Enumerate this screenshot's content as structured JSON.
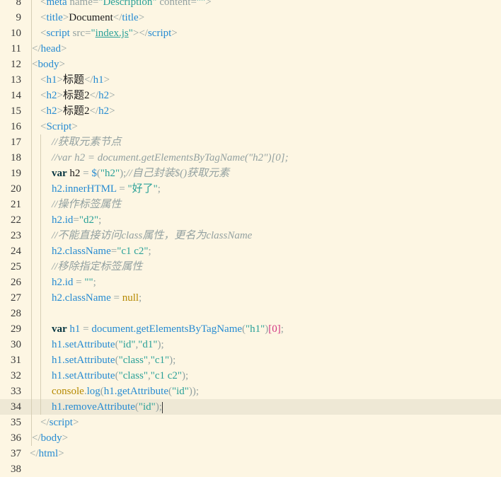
{
  "colors": {
    "background": "#fdf6e3",
    "active_line": "#eee8d5",
    "punct": "#93a1a1",
    "tag": "#268bd2",
    "attr": "#93a1a1",
    "string": "#2aa198",
    "keyword": "#073642",
    "builtin": "#b58900",
    "comment": "#93a1a1",
    "text": "#586e75",
    "number": "#d33682"
  },
  "lines": [
    {
      "n": "8",
      "indent": 1,
      "tokens": [
        [
          "p",
          "<"
        ],
        [
          "tag",
          "meta"
        ],
        [
          "t",
          " "
        ],
        [
          "attr",
          "name"
        ],
        [
          "p",
          "="
        ],
        [
          "s",
          "\"Description\""
        ],
        [
          "t",
          " "
        ],
        [
          "attr",
          "content"
        ],
        [
          "p",
          "="
        ],
        [
          "s",
          "\"\""
        ],
        [
          "p",
          ">"
        ]
      ]
    },
    {
      "n": "9",
      "indent": 1,
      "tokens": [
        [
          "p",
          "<"
        ],
        [
          "tag",
          "title"
        ],
        [
          "p",
          ">"
        ],
        [
          "t",
          "Document"
        ],
        [
          "p",
          "</"
        ],
        [
          "tag",
          "title"
        ],
        [
          "p",
          ">"
        ]
      ]
    },
    {
      "n": "10",
      "indent": 1,
      "tokens": [
        [
          "p",
          "<"
        ],
        [
          "tag",
          "script"
        ],
        [
          "t",
          " "
        ],
        [
          "attr",
          "src"
        ],
        [
          "p",
          "="
        ],
        [
          "s",
          "\""
        ],
        [
          "su",
          "index.js"
        ],
        [
          "s",
          "\""
        ],
        [
          "p",
          "></"
        ],
        [
          "tag",
          "script"
        ],
        [
          "p",
          ">"
        ]
      ]
    },
    {
      "n": "11",
      "indent": 0,
      "tokens": [
        [
          "p",
          "</"
        ],
        [
          "tag",
          "head"
        ],
        [
          "p",
          ">"
        ]
      ]
    },
    {
      "n": "12",
      "indent": 0,
      "tokens": [
        [
          "p",
          "<"
        ],
        [
          "tag",
          "body"
        ],
        [
          "p",
          ">"
        ]
      ]
    },
    {
      "n": "13",
      "indent": 1,
      "tokens": [
        [
          "p",
          "<"
        ],
        [
          "tag",
          "h1"
        ],
        [
          "p",
          ">"
        ],
        [
          "t",
          "标题"
        ],
        [
          "p",
          "</"
        ],
        [
          "tag",
          "h1"
        ],
        [
          "p",
          ">"
        ]
      ]
    },
    {
      "n": "14",
      "indent": 1,
      "tokens": [
        [
          "p",
          "<"
        ],
        [
          "tag",
          "h2"
        ],
        [
          "p",
          ">"
        ],
        [
          "t",
          "标题2"
        ],
        [
          "p",
          "</"
        ],
        [
          "tag",
          "h2"
        ],
        [
          "p",
          ">"
        ]
      ]
    },
    {
      "n": "15",
      "indent": 1,
      "tokens": [
        [
          "p",
          "<"
        ],
        [
          "tag",
          "h2"
        ],
        [
          "p",
          ">"
        ],
        [
          "t",
          "标题2"
        ],
        [
          "p",
          "</"
        ],
        [
          "tag",
          "h2"
        ],
        [
          "p",
          ">"
        ]
      ]
    },
    {
      "n": "16",
      "indent": 1,
      "tokens": [
        [
          "p",
          "<"
        ],
        [
          "tag",
          "Script"
        ],
        [
          "p",
          ">"
        ]
      ]
    },
    {
      "n": "17",
      "indent": 2,
      "tokens": [
        [
          "c",
          "//获取元素节点"
        ]
      ]
    },
    {
      "n": "18",
      "indent": 2,
      "tokens": [
        [
          "c",
          "//var h2 = document.getElementsByTagName(\"h2\")[0];"
        ]
      ]
    },
    {
      "n": "19",
      "indent": 2,
      "tokens": [
        [
          "k",
          "var"
        ],
        [
          "t",
          " h2 "
        ],
        [
          "p",
          "="
        ],
        [
          "t",
          " "
        ],
        [
          "f",
          "$"
        ],
        [
          "p",
          "("
        ],
        [
          "s",
          "\"h2\""
        ],
        [
          "p",
          ");"
        ],
        [
          "c",
          "//自己封装$()获取元素"
        ]
      ]
    },
    {
      "n": "20",
      "indent": 2,
      "tokens": [
        [
          "v",
          "h2.innerHTML"
        ],
        [
          "t",
          " "
        ],
        [
          "p",
          "="
        ],
        [
          "t",
          " "
        ],
        [
          "s",
          "\"好了\""
        ],
        [
          "p",
          ";"
        ]
      ]
    },
    {
      "n": "21",
      "indent": 2,
      "tokens": [
        [
          "c",
          "//操作标签属性"
        ]
      ]
    },
    {
      "n": "22",
      "indent": 2,
      "tokens": [
        [
          "v",
          "h2.id"
        ],
        [
          "p",
          "="
        ],
        [
          "s",
          "\"d2\""
        ],
        [
          "p",
          ";"
        ]
      ]
    },
    {
      "n": "23",
      "indent": 2,
      "tokens": [
        [
          "c",
          "//不能直接访问class属性，更名为className"
        ]
      ]
    },
    {
      "n": "24",
      "indent": 2,
      "tokens": [
        [
          "v",
          "h2.className"
        ],
        [
          "p",
          "="
        ],
        [
          "s",
          "\"c1 c2\""
        ],
        [
          "p",
          ";"
        ]
      ]
    },
    {
      "n": "25",
      "indent": 2,
      "tokens": [
        [
          "c",
          "//移除指定标签属性"
        ]
      ]
    },
    {
      "n": "26",
      "indent": 2,
      "tokens": [
        [
          "v",
          "h2.id"
        ],
        [
          "t",
          " "
        ],
        [
          "p",
          "="
        ],
        [
          "t",
          " "
        ],
        [
          "s",
          "\"\""
        ],
        [
          "p",
          ";"
        ]
      ]
    },
    {
      "n": "27",
      "indent": 2,
      "tokens": [
        [
          "v",
          "h2.className"
        ],
        [
          "t",
          " "
        ],
        [
          "p",
          "="
        ],
        [
          "t",
          " "
        ],
        [
          "b",
          "null"
        ],
        [
          "p",
          ";"
        ]
      ]
    },
    {
      "n": "28",
      "indent": 2,
      "tokens": []
    },
    {
      "n": "29",
      "indent": 2,
      "tokens": [
        [
          "k",
          "var"
        ],
        [
          "t",
          " "
        ],
        [
          "v",
          "h1"
        ],
        [
          "t",
          " "
        ],
        [
          "p",
          "="
        ],
        [
          "t",
          " "
        ],
        [
          "v",
          "document.getElementsByTagName"
        ],
        [
          "p",
          "("
        ],
        [
          "s",
          "\"h1\""
        ],
        [
          "p",
          ")"
        ],
        [
          "n",
          "[0]"
        ],
        [
          "p",
          ";"
        ]
      ]
    },
    {
      "n": "30",
      "indent": 2,
      "tokens": [
        [
          "v",
          "h1.setAttribute"
        ],
        [
          "p",
          "("
        ],
        [
          "s",
          "\"id\""
        ],
        [
          "p",
          ","
        ],
        [
          "s",
          "\"d1\""
        ],
        [
          "p",
          ");"
        ]
      ]
    },
    {
      "n": "31",
      "indent": 2,
      "tokens": [
        [
          "v",
          "h1.setAttribute"
        ],
        [
          "p",
          "("
        ],
        [
          "s",
          "\"class\""
        ],
        [
          "p",
          ","
        ],
        [
          "s",
          "\"c1\""
        ],
        [
          "p",
          ");"
        ]
      ]
    },
    {
      "n": "32",
      "indent": 2,
      "tokens": [
        [
          "v",
          "h1.setAttribute"
        ],
        [
          "p",
          "("
        ],
        [
          "s",
          "\"class\""
        ],
        [
          "p",
          ","
        ],
        [
          "s",
          "\"c1 c2\""
        ],
        [
          "p",
          ");"
        ]
      ]
    },
    {
      "n": "33",
      "indent": 2,
      "tokens": [
        [
          "b",
          "console"
        ],
        [
          "p",
          "."
        ],
        [
          "v",
          "log"
        ],
        [
          "p",
          "("
        ],
        [
          "v",
          "h1.getAttribute"
        ],
        [
          "p",
          "("
        ],
        [
          "s",
          "\"id\""
        ],
        [
          "p",
          "));"
        ]
      ]
    },
    {
      "n": "34",
      "indent": 2,
      "active": true,
      "tokens": [
        [
          "v",
          "h1.removeAttribute"
        ],
        [
          "p",
          "("
        ],
        [
          "s",
          "\"id\""
        ],
        [
          "p",
          ");"
        ]
      ]
    },
    {
      "n": "35",
      "indent": 1,
      "tokens": [
        [
          "p",
          "</"
        ],
        [
          "tag",
          "script"
        ],
        [
          "p",
          ">"
        ]
      ]
    },
    {
      "n": "36",
      "indent": 0,
      "tokens": [
        [
          "p",
          "</"
        ],
        [
          "tag",
          "body"
        ],
        [
          "p",
          ">"
        ]
      ]
    },
    {
      "n": "37",
      "indent": -1,
      "tokens": [
        [
          "p",
          "</"
        ],
        [
          "tag",
          "html"
        ],
        [
          "p",
          ">"
        ]
      ]
    },
    {
      "n": "38",
      "indent": -1,
      "tokens": []
    }
  ]
}
